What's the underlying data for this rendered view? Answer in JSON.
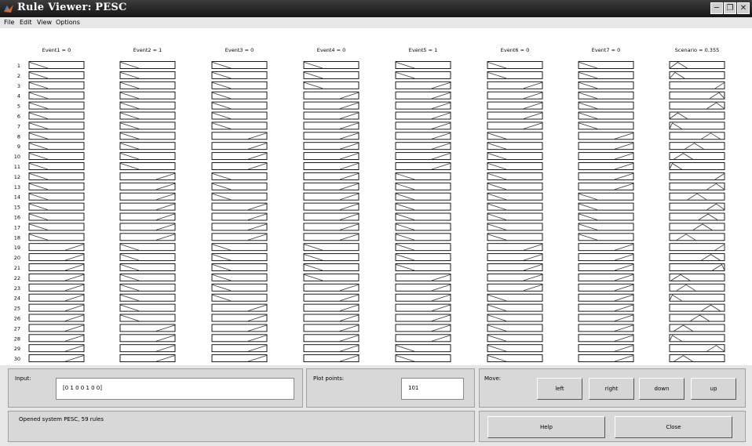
{
  "window": {
    "title": "Rule Viewer: PESC"
  },
  "menu": [
    "File",
    "Edit",
    "View",
    "Options"
  ],
  "columns": [
    {
      "label": "Event1 = 0"
    },
    {
      "label": "Event2 = 1"
    },
    {
      "label": "Event3 = 0"
    },
    {
      "label": "Event4 = 0"
    },
    {
      "label": "Event5 = 1"
    },
    {
      "label": "Event6 = 0"
    },
    {
      "label": "Event7 = 0"
    },
    {
      "label": "Scenario = 0.355"
    }
  ],
  "rule_numbers": [
    "1",
    "2",
    "3",
    "4",
    "5",
    "6",
    "7",
    "8",
    "9",
    "10",
    "11",
    "12",
    "13",
    "14",
    "15",
    "16",
    "17",
    "18",
    "19",
    "20",
    "21",
    "22",
    "23",
    "24",
    "25",
    "26",
    "27",
    "28",
    "29",
    "30"
  ],
  "input": {
    "label": "Input:",
    "value": "[0 1 0 0 1 0 0]"
  },
  "plot_points": {
    "label": "Plot points:",
    "value": "101"
  },
  "move": {
    "label": "Move:",
    "buttons": [
      "left",
      "right",
      "down",
      "up"
    ]
  },
  "status": "Opened system PESC, 59 rules",
  "help_label": "Help",
  "close_label": "Close"
}
